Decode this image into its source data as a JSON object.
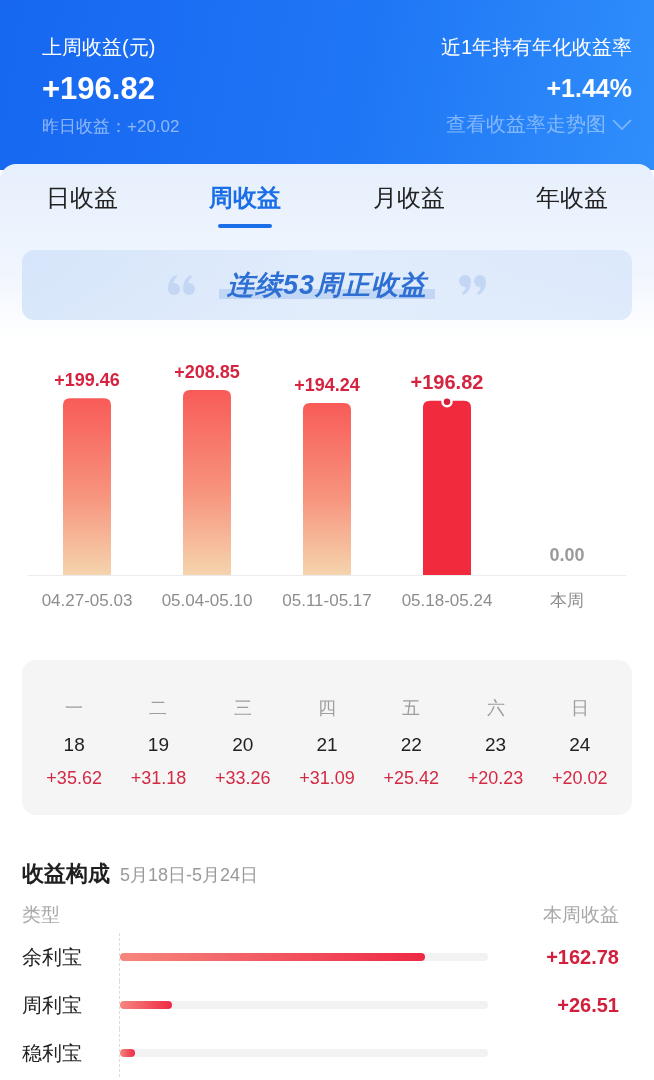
{
  "header": {
    "last_week": {
      "label": "上周收益(元)",
      "value": "+196.82",
      "yesterday": "昨日收益：+20.02"
    },
    "annual": {
      "label": "近1年持有年化收益率",
      "value": "+1.44%",
      "link": "查看收益率走势图"
    }
  },
  "tabs": [
    {
      "label": "日收益",
      "selected": false
    },
    {
      "label": "周收益",
      "selected": true
    },
    {
      "label": "月收益",
      "selected": false
    },
    {
      "label": "年收益",
      "selected": false
    }
  ],
  "streak_banner": {
    "text": "连续53周正收益"
  },
  "weekly_chart": {
    "chart_data": {
      "type": "bar",
      "categories": [
        "04.27-05.03",
        "05.04-05.10",
        "05.11-05.17",
        "05.18-05.24",
        "本周"
      ],
      "values": [
        199.46,
        208.85,
        194.24,
        196.82,
        0
      ],
      "value_labels": [
        "+199.46",
        "+208.85",
        "+194.24",
        "+196.82",
        "0.00"
      ]
    },
    "bars": [
      {
        "selected": false
      },
      {
        "selected": false
      },
      {
        "selected": false
      },
      {
        "selected": true
      },
      {
        "selected": false
      }
    ]
  },
  "week_days": [
    {
      "weekday": "一",
      "date": "18",
      "amount": "+35.62"
    },
    {
      "weekday": "二",
      "date": "19",
      "amount": "+31.18"
    },
    {
      "weekday": "三",
      "date": "20",
      "amount": "+33.26"
    },
    {
      "weekday": "四",
      "date": "21",
      "amount": "+31.09"
    },
    {
      "weekday": "五",
      "date": "22",
      "amount": "+25.42"
    },
    {
      "weekday": "六",
      "date": "23",
      "amount": "+20.23"
    },
    {
      "weekday": "日",
      "date": "24",
      "amount": "+20.02"
    }
  ],
  "breakdown": {
    "title": "收益构成",
    "period": "5月18日-5月24日",
    "columns": [
      "类型",
      "本周收益"
    ],
    "rows": [
      {
        "name": "余利宝",
        "level": 0.83,
        "amount": "+162.78"
      },
      {
        "name": "周利宝",
        "level": 0.14,
        "amount": "+26.51"
      },
      {
        "name": "稳利宝",
        "level": 0.04
      }
    ]
  }
}
